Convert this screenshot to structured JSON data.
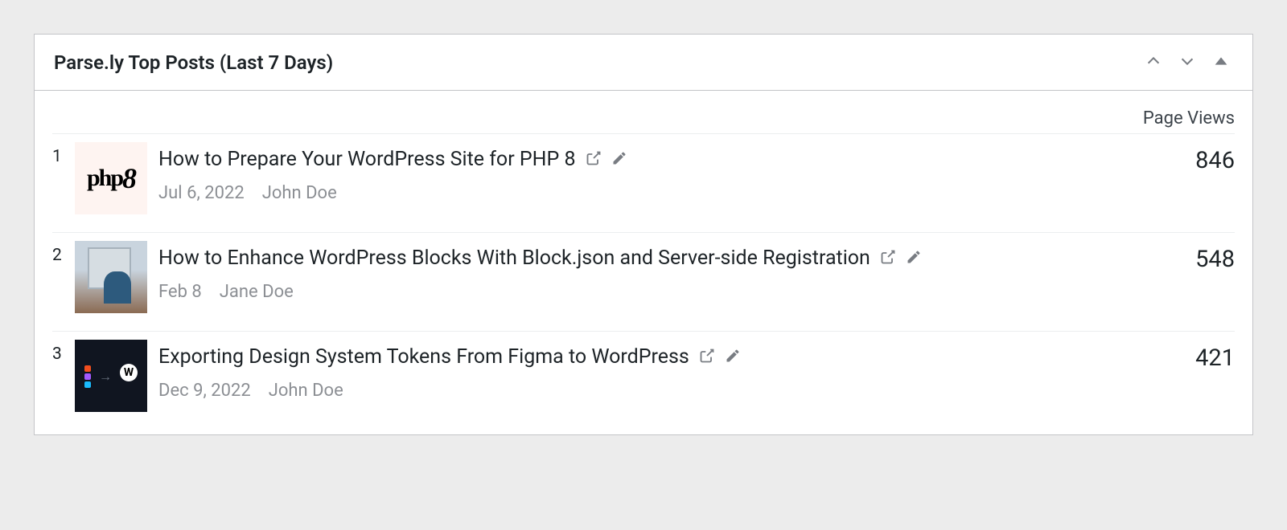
{
  "widget": {
    "title": "Parse.ly Top Posts (Last 7 Days)",
    "column_header": "Page Views"
  },
  "posts": [
    {
      "rank": "1",
      "title": "How to Prepare Your WordPress Site for PHP 8",
      "date": "Jul 6, 2022",
      "author": "John Doe",
      "views": "846",
      "thumb_type": "php8"
    },
    {
      "rank": "2",
      "title": "How to Enhance WordPress Blocks With Block.json and Server-side Registration",
      "date": "Feb 8",
      "author": "Jane Doe",
      "views": "548",
      "thumb_type": "office"
    },
    {
      "rank": "3",
      "title": "Exporting Design System Tokens From Figma to WordPress",
      "date": "Dec 9, 2022",
      "author": "John Doe",
      "views": "421",
      "thumb_type": "figma"
    }
  ]
}
